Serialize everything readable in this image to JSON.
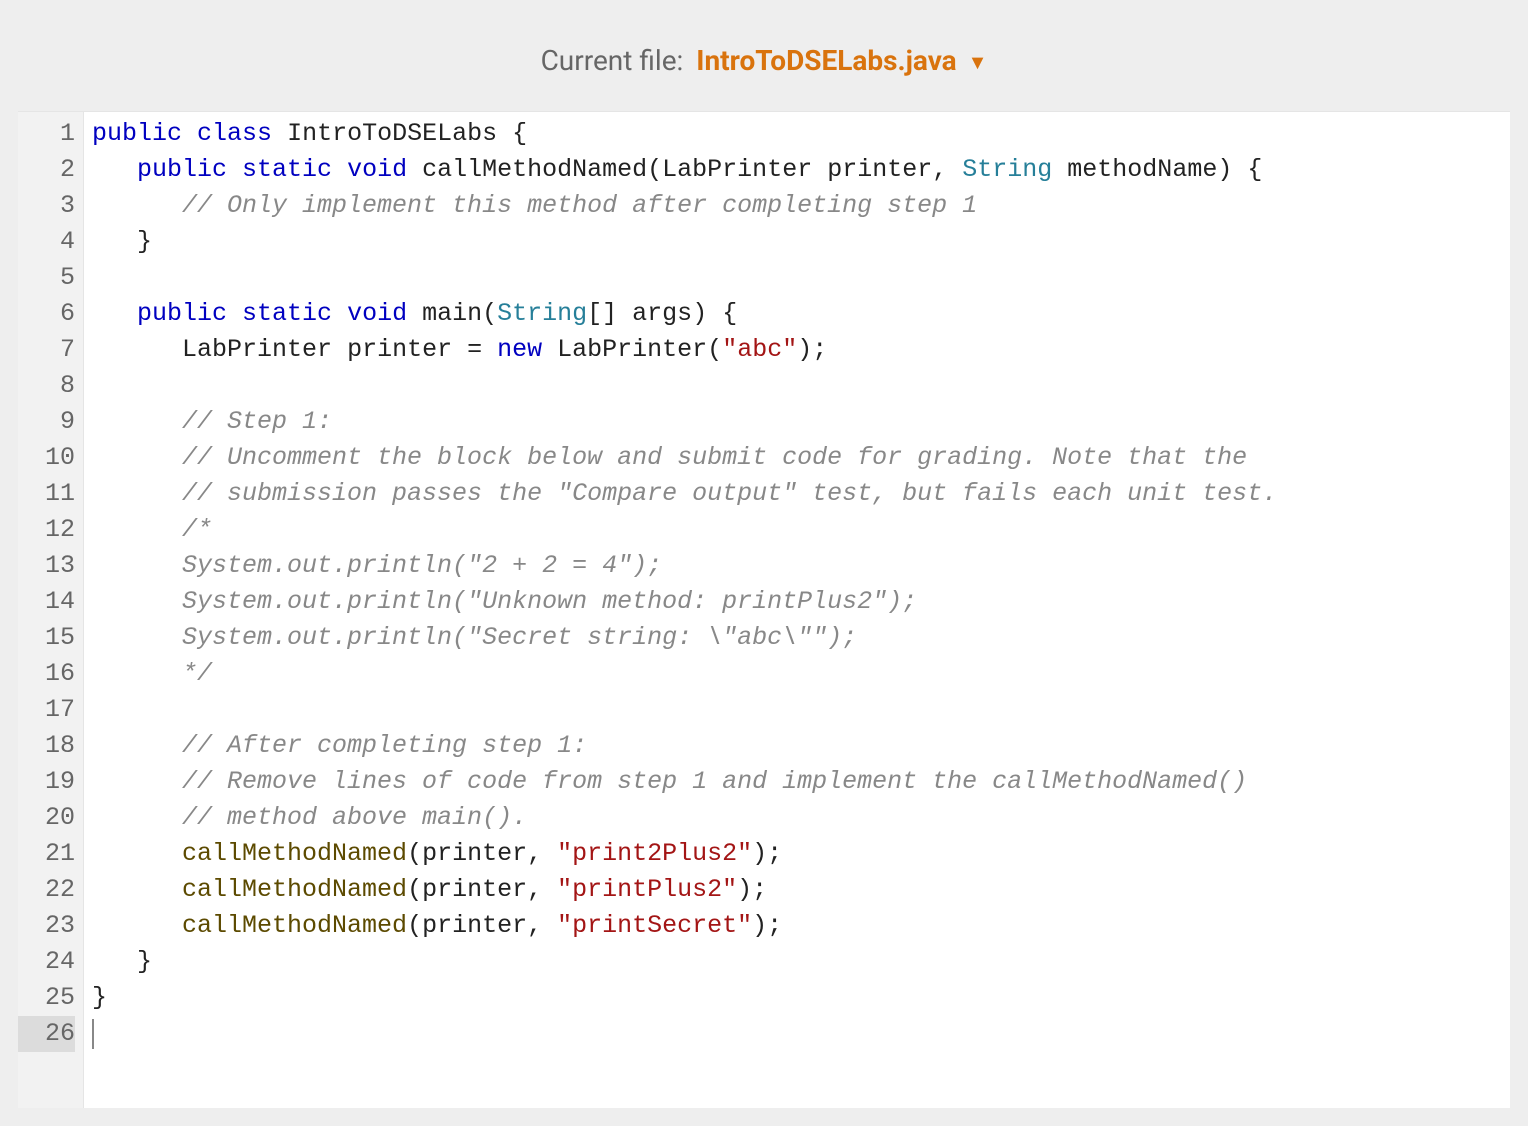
{
  "header": {
    "label": "Current file:",
    "filename": "IntroToDSELabs.java"
  },
  "editor": {
    "line_count": 26,
    "current_line": 26,
    "lines": [
      {
        "n": 1,
        "tokens": [
          {
            "t": "public",
            "c": "kw"
          },
          {
            "t": " ",
            "c": "sp"
          },
          {
            "t": "class",
            "c": "kw"
          },
          {
            "t": " ",
            "c": "sp"
          },
          {
            "t": "IntroToDSELabs",
            "c": "ident"
          },
          {
            "t": " {",
            "c": "punct"
          }
        ]
      },
      {
        "n": 2,
        "tokens": [
          {
            "t": "   ",
            "c": "sp"
          },
          {
            "t": "public",
            "c": "kw"
          },
          {
            "t": " ",
            "c": "sp"
          },
          {
            "t": "static",
            "c": "kw"
          },
          {
            "t": " ",
            "c": "sp"
          },
          {
            "t": "void",
            "c": "kw"
          },
          {
            "t": " ",
            "c": "sp"
          },
          {
            "t": "callMethodNamed",
            "c": "ident"
          },
          {
            "t": "(",
            "c": "punct"
          },
          {
            "t": "LabPrinter",
            "c": "ident"
          },
          {
            "t": " ",
            "c": "sp"
          },
          {
            "t": "printer",
            "c": "ident"
          },
          {
            "t": ", ",
            "c": "punct"
          },
          {
            "t": "String",
            "c": "type"
          },
          {
            "t": " ",
            "c": "sp"
          },
          {
            "t": "methodName",
            "c": "ident"
          },
          {
            "t": ") {",
            "c": "punct"
          }
        ]
      },
      {
        "n": 3,
        "tokens": [
          {
            "t": "      ",
            "c": "sp"
          },
          {
            "t": "// Only implement this method after completing step 1",
            "c": "comment"
          }
        ]
      },
      {
        "n": 4,
        "tokens": [
          {
            "t": "   ",
            "c": "sp"
          },
          {
            "t": "}",
            "c": "punct"
          }
        ]
      },
      {
        "n": 5,
        "tokens": []
      },
      {
        "n": 6,
        "tokens": [
          {
            "t": "   ",
            "c": "sp"
          },
          {
            "t": "public",
            "c": "kw"
          },
          {
            "t": " ",
            "c": "sp"
          },
          {
            "t": "static",
            "c": "kw"
          },
          {
            "t": " ",
            "c": "sp"
          },
          {
            "t": "void",
            "c": "kw"
          },
          {
            "t": " ",
            "c": "sp"
          },
          {
            "t": "main",
            "c": "ident"
          },
          {
            "t": "(",
            "c": "punct"
          },
          {
            "t": "String",
            "c": "type"
          },
          {
            "t": "[] ",
            "c": "punct"
          },
          {
            "t": "args",
            "c": "ident"
          },
          {
            "t": ") {",
            "c": "punct"
          }
        ]
      },
      {
        "n": 7,
        "tokens": [
          {
            "t": "      ",
            "c": "sp"
          },
          {
            "t": "LabPrinter",
            "c": "ident"
          },
          {
            "t": " ",
            "c": "sp"
          },
          {
            "t": "printer",
            "c": "ident"
          },
          {
            "t": " = ",
            "c": "punct"
          },
          {
            "t": "new",
            "c": "kw"
          },
          {
            "t": " ",
            "c": "sp"
          },
          {
            "t": "LabPrinter",
            "c": "ident"
          },
          {
            "t": "(",
            "c": "punct"
          },
          {
            "t": "\"abc\"",
            "c": "str"
          },
          {
            "t": ");",
            "c": "punct"
          }
        ]
      },
      {
        "n": 8,
        "tokens": []
      },
      {
        "n": 9,
        "tokens": [
          {
            "t": "      ",
            "c": "sp"
          },
          {
            "t": "// Step 1:",
            "c": "comment"
          }
        ]
      },
      {
        "n": 10,
        "tokens": [
          {
            "t": "      ",
            "c": "sp"
          },
          {
            "t": "// Uncomment the block below and submit code for grading. Note that the",
            "c": "comment"
          }
        ]
      },
      {
        "n": 11,
        "tokens": [
          {
            "t": "      ",
            "c": "sp"
          },
          {
            "t": "// submission passes the \"Compare output\" test, but fails each unit test.",
            "c": "comment"
          }
        ]
      },
      {
        "n": 12,
        "tokens": [
          {
            "t": "      ",
            "c": "sp"
          },
          {
            "t": "/*",
            "c": "comment"
          }
        ]
      },
      {
        "n": 13,
        "tokens": [
          {
            "t": "      ",
            "c": "sp"
          },
          {
            "t": "System.out.println(\"2 + 2 = 4\");",
            "c": "comment"
          }
        ]
      },
      {
        "n": 14,
        "tokens": [
          {
            "t": "      ",
            "c": "sp"
          },
          {
            "t": "System.out.println(\"Unknown method: printPlus2\");",
            "c": "comment"
          }
        ]
      },
      {
        "n": 15,
        "tokens": [
          {
            "t": "      ",
            "c": "sp"
          },
          {
            "t": "System.out.println(\"Secret string: \\\"abc\\\"\");",
            "c": "comment"
          }
        ]
      },
      {
        "n": 16,
        "tokens": [
          {
            "t": "      ",
            "c": "sp"
          },
          {
            "t": "*/",
            "c": "comment"
          }
        ]
      },
      {
        "n": 17,
        "tokens": []
      },
      {
        "n": 18,
        "tokens": [
          {
            "t": "      ",
            "c": "sp"
          },
          {
            "t": "// After completing step 1:",
            "c": "comment"
          }
        ]
      },
      {
        "n": 19,
        "tokens": [
          {
            "t": "      ",
            "c": "sp"
          },
          {
            "t": "// Remove lines of code from step 1 and implement the callMethodNamed()",
            "c": "comment"
          }
        ]
      },
      {
        "n": 20,
        "tokens": [
          {
            "t": "      ",
            "c": "sp"
          },
          {
            "t": "// method above main().",
            "c": "comment"
          }
        ]
      },
      {
        "n": 21,
        "tokens": [
          {
            "t": "      ",
            "c": "sp"
          },
          {
            "t": "callMethodNamed",
            "c": "method"
          },
          {
            "t": "(",
            "c": "punct"
          },
          {
            "t": "printer",
            "c": "ident"
          },
          {
            "t": ", ",
            "c": "punct"
          },
          {
            "t": "\"print2Plus2\"",
            "c": "str"
          },
          {
            "t": ");",
            "c": "punct"
          }
        ]
      },
      {
        "n": 22,
        "tokens": [
          {
            "t": "      ",
            "c": "sp"
          },
          {
            "t": "callMethodNamed",
            "c": "method"
          },
          {
            "t": "(",
            "c": "punct"
          },
          {
            "t": "printer",
            "c": "ident"
          },
          {
            "t": ", ",
            "c": "punct"
          },
          {
            "t": "\"printPlus2\"",
            "c": "str"
          },
          {
            "t": ");",
            "c": "punct"
          }
        ]
      },
      {
        "n": 23,
        "tokens": [
          {
            "t": "      ",
            "c": "sp"
          },
          {
            "t": "callMethodNamed",
            "c": "method"
          },
          {
            "t": "(",
            "c": "punct"
          },
          {
            "t": "printer",
            "c": "ident"
          },
          {
            "t": ", ",
            "c": "punct"
          },
          {
            "t": "\"printSecret\"",
            "c": "str"
          },
          {
            "t": ");",
            "c": "punct"
          }
        ]
      },
      {
        "n": 24,
        "tokens": [
          {
            "t": "   ",
            "c": "sp"
          },
          {
            "t": "}",
            "c": "punct"
          }
        ]
      },
      {
        "n": 25,
        "tokens": [
          {
            "t": "}",
            "c": "punct"
          }
        ]
      },
      {
        "n": 26,
        "tokens": []
      }
    ]
  }
}
